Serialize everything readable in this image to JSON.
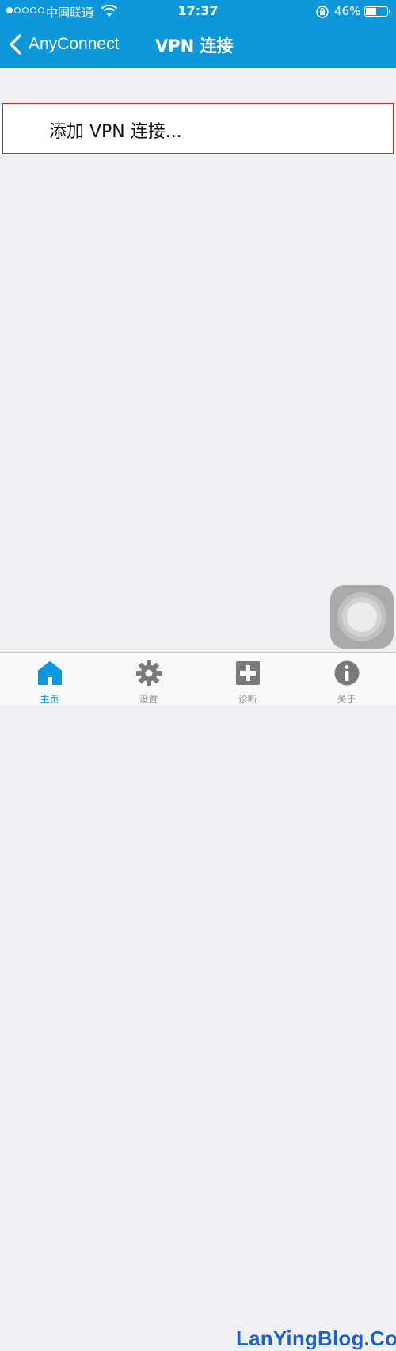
{
  "status_bar": {
    "carrier": "中国联通",
    "time": "17:37",
    "battery_percent": "46%",
    "battery_level": 0.46,
    "signal_strength_dots": 1,
    "icons": [
      "signal-dots-icon",
      "wifi-icon",
      "rotation-lock-icon",
      "battery-icon"
    ]
  },
  "nav": {
    "back_label": "AnyConnect",
    "title": "VPN 连接"
  },
  "content": {
    "add_vpn_label": "添加 VPN 连接..."
  },
  "tabs": [
    {
      "label": "主页",
      "icon": "home-icon",
      "active": true
    },
    {
      "label": "设置",
      "icon": "gear-icon",
      "active": false
    },
    {
      "label": "诊断",
      "icon": "diagnostics-plus-icon",
      "active": false
    },
    {
      "label": "关于",
      "icon": "info-icon",
      "active": false
    }
  ],
  "watermark": "LanYingBlog.Com",
  "colors": {
    "accent": "#0d98dc",
    "background": "#efeff4",
    "highlight": "#e02020",
    "tab_inactive": "#8e8e93"
  }
}
